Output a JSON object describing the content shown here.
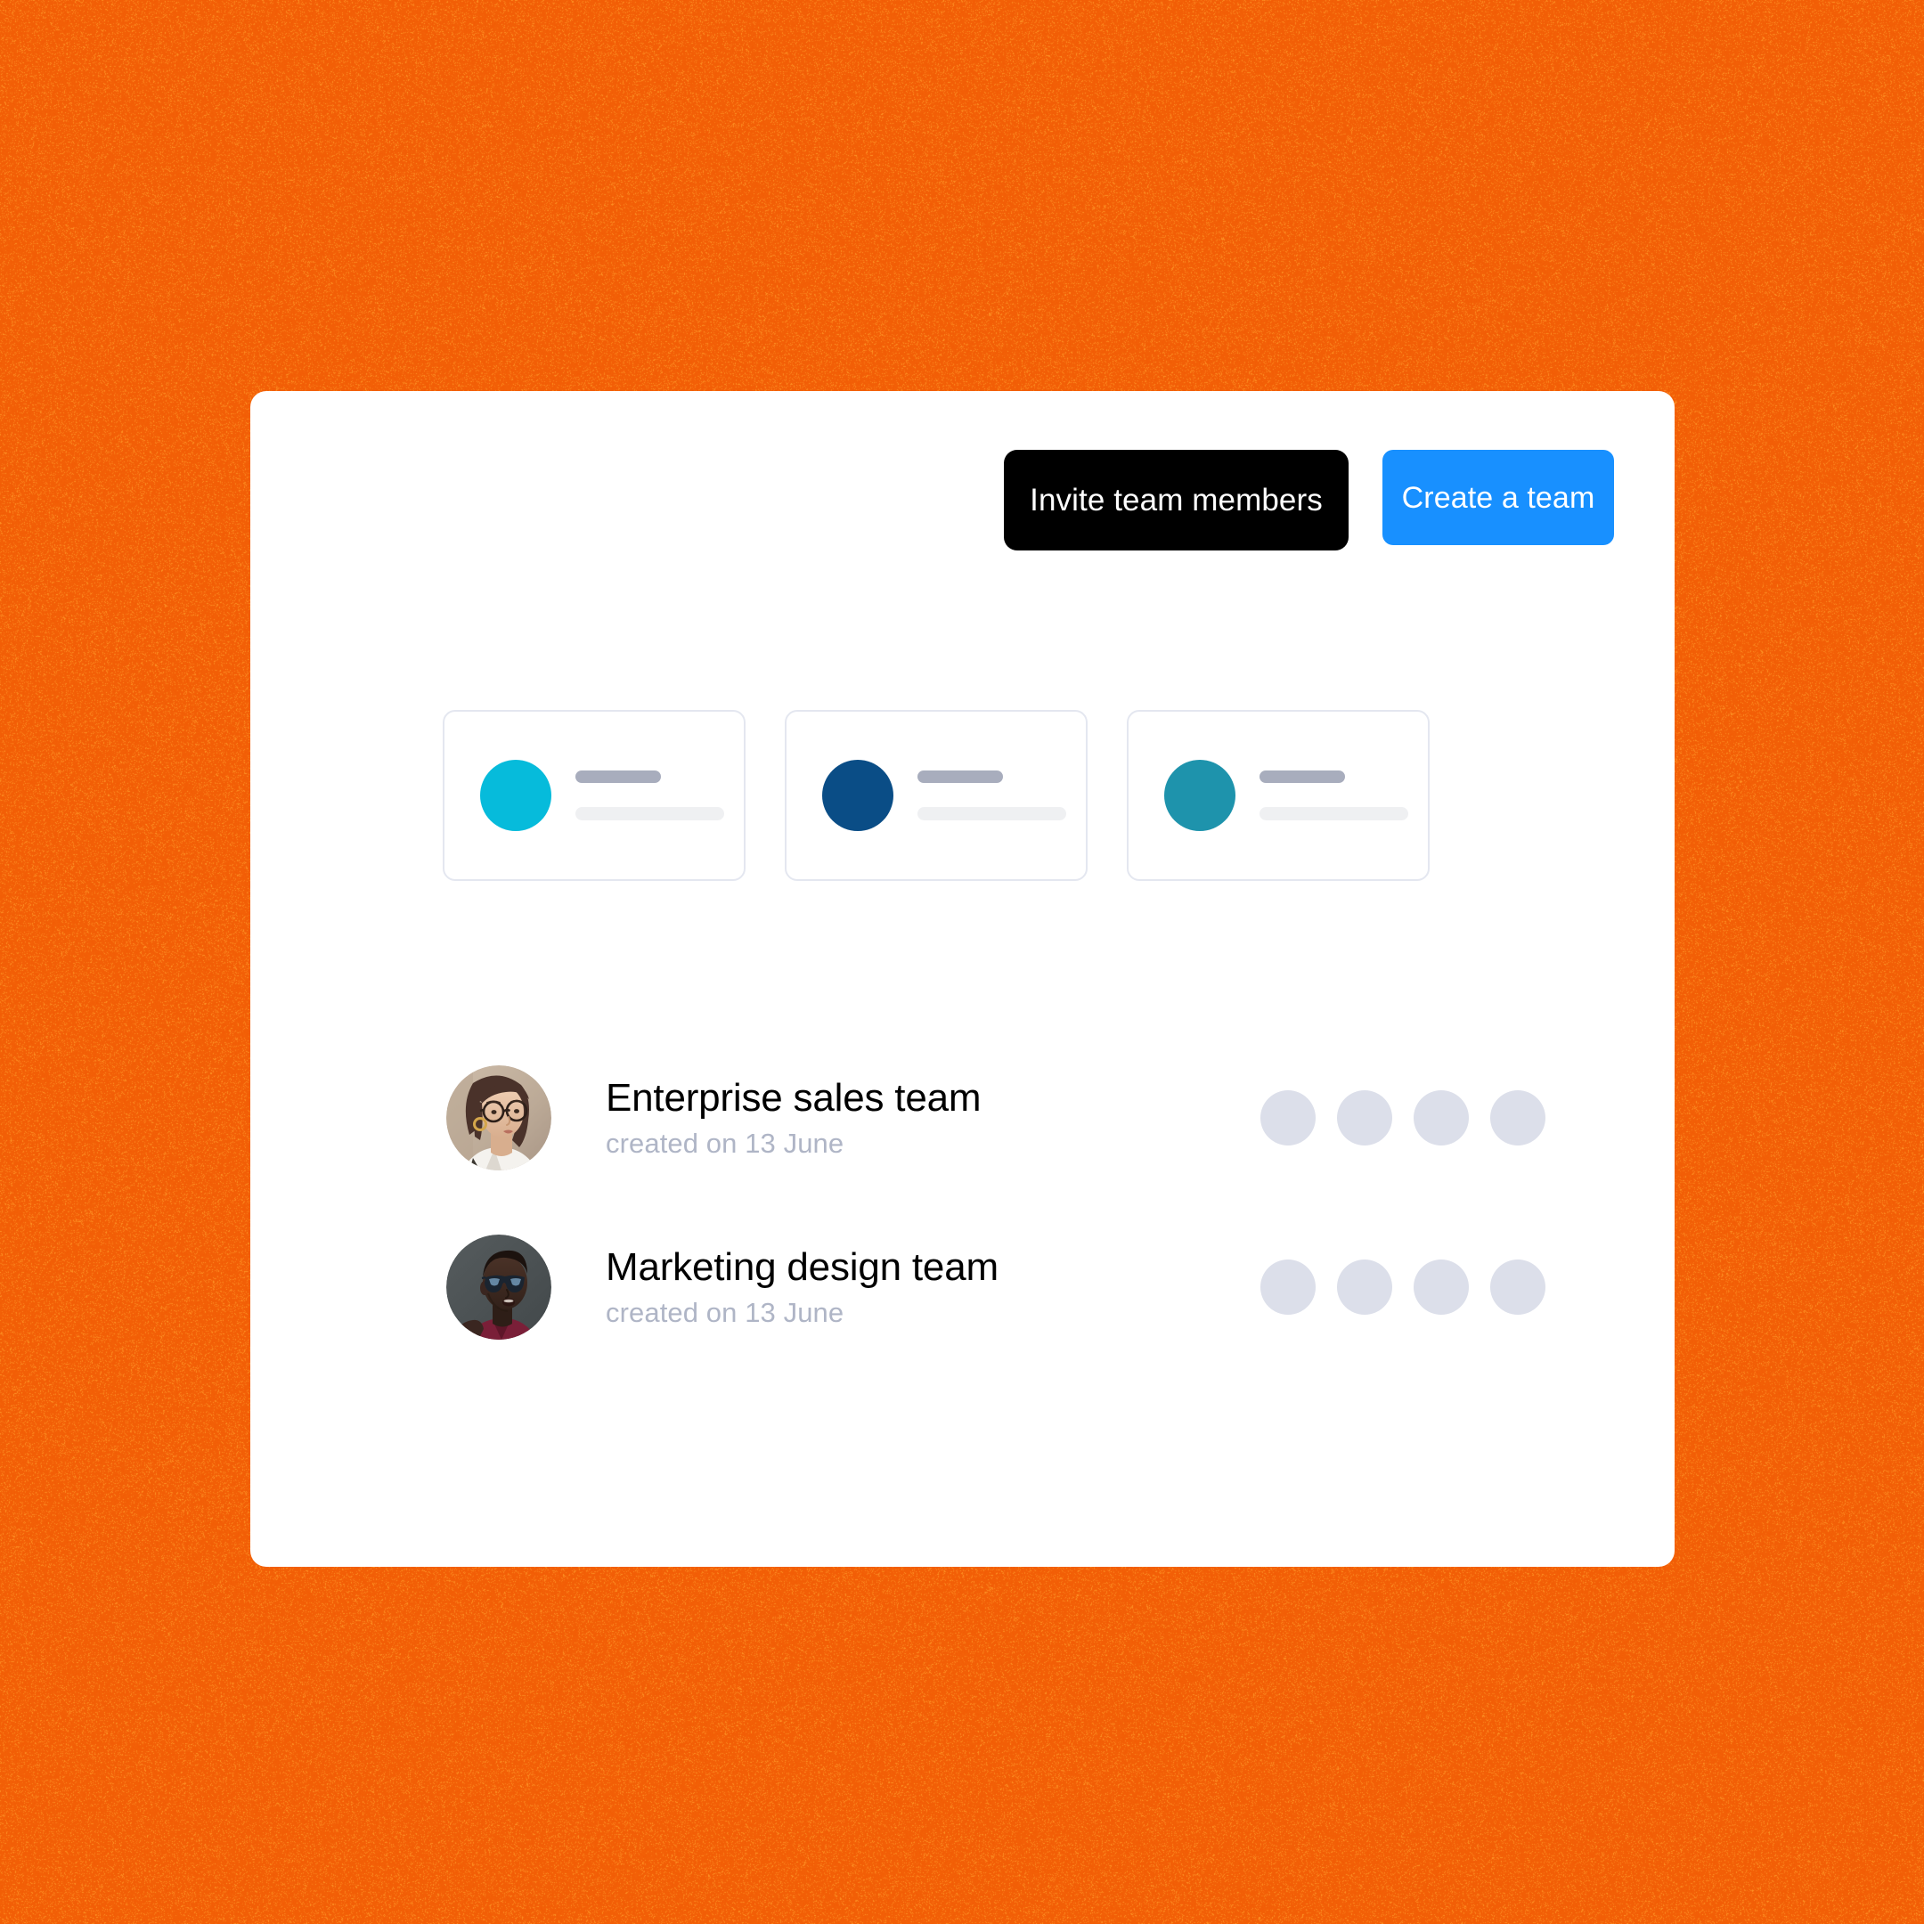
{
  "background": {
    "color": "#F25C05",
    "noise_color": "#FF9A29",
    "texture": "grain-noise"
  },
  "panel": {
    "background": "#FFFFFF",
    "corner_radius": 18
  },
  "toolbar": {
    "invite_label": "Invite team members",
    "invite_bg": "#000000",
    "create_label": "Create a team",
    "create_bg": "#1890FF"
  },
  "skeleton_cards": [
    {
      "dot_color": "#06BBDB",
      "bar_top_color": "#A8ADBD",
      "bar_bottom_color": "#EFF0F2",
      "bar_top_width": 96
    },
    {
      "dot_color": "#0A4D86",
      "bar_top_color": "#A8ADBD",
      "bar_bottom_color": "#EFF0F2",
      "bar_top_width": 96
    },
    {
      "dot_color": "#1E93AC",
      "bar_top_color": "#A8ADBD",
      "bar_bottom_color": "#EFF0F2",
      "bar_top_width": 96
    }
  ],
  "teams": [
    {
      "name": "Enterprise sales team",
      "meta": "created on 13 June",
      "avatar": "woman-with-glasses-photo",
      "member_count": 4,
      "member_dot_color": "#DCDFEA"
    },
    {
      "name": "Marketing design team",
      "meta": "created on 13 June",
      "avatar": "man-with-sunglasses-photo",
      "member_count": 4,
      "member_dot_color": "#DCDFEA"
    }
  ]
}
